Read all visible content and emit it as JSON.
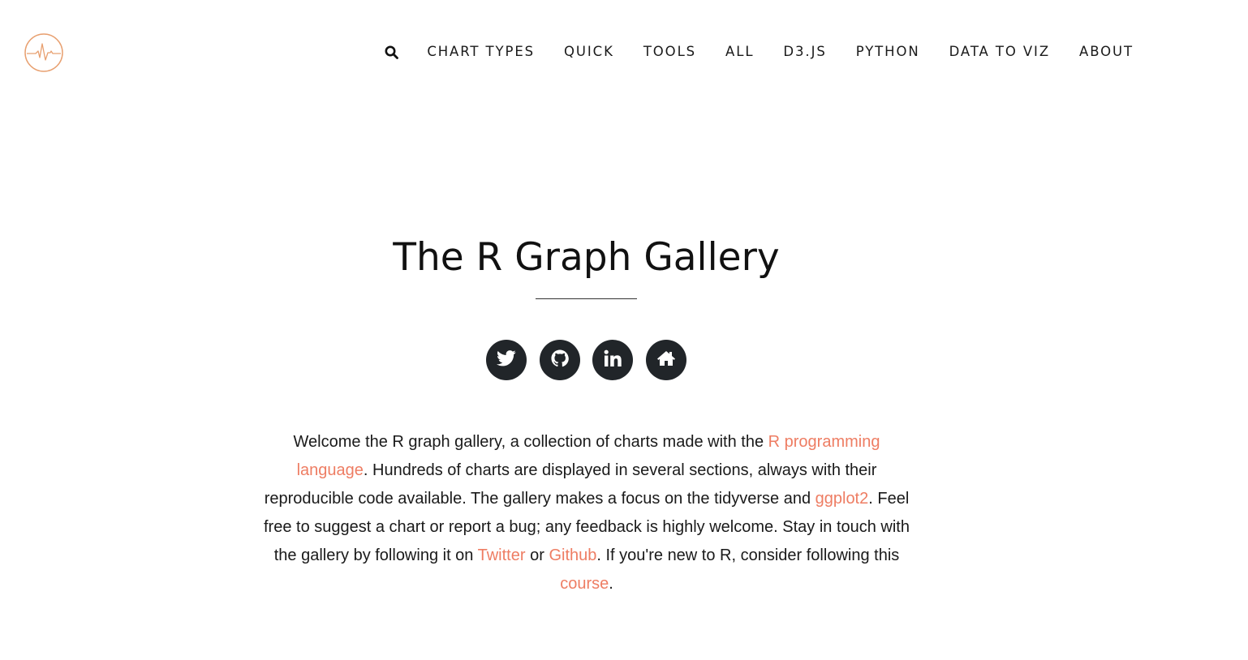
{
  "colors": {
    "accent": "#ee7d63",
    "logo_stroke": "#e8a070",
    "icon_button_bg": "#212529",
    "text": "#111111"
  },
  "header": {
    "logo_icon": "heartbeat-logo-icon",
    "search_icon": "search-icon",
    "nav": [
      {
        "label": "CHART TYPES"
      },
      {
        "label": "QUICK"
      },
      {
        "label": "TOOLS"
      },
      {
        "label": "ALL"
      },
      {
        "label": "D3.JS"
      },
      {
        "label": "PYTHON"
      },
      {
        "label": "DATA TO VIZ"
      },
      {
        "label": "ABOUT"
      }
    ]
  },
  "hero": {
    "title": "The R Graph Gallery",
    "social": [
      {
        "icon": "twitter-icon"
      },
      {
        "icon": "github-icon"
      },
      {
        "icon": "linkedin-icon"
      },
      {
        "icon": "home-icon"
      }
    ]
  },
  "intro": {
    "t1": "Welcome the R graph gallery, a collection of charts made with the ",
    "link_r": "R programming language",
    "t2": ". Hundreds of charts are displayed in several sections, always with their reproducible code available. The gallery makes a focus on the tidyverse and ",
    "link_ggplot2": "ggplot2",
    "t3": ". Feel free to suggest a chart or report a bug; any feedback is highly welcome. Stay in touch with the gallery by following it on ",
    "link_twitter": "Twitter",
    "t4": " or ",
    "link_github": "Github",
    "t5": ". If you're new to R, consider following this ",
    "link_course": "course",
    "t6": "."
  }
}
